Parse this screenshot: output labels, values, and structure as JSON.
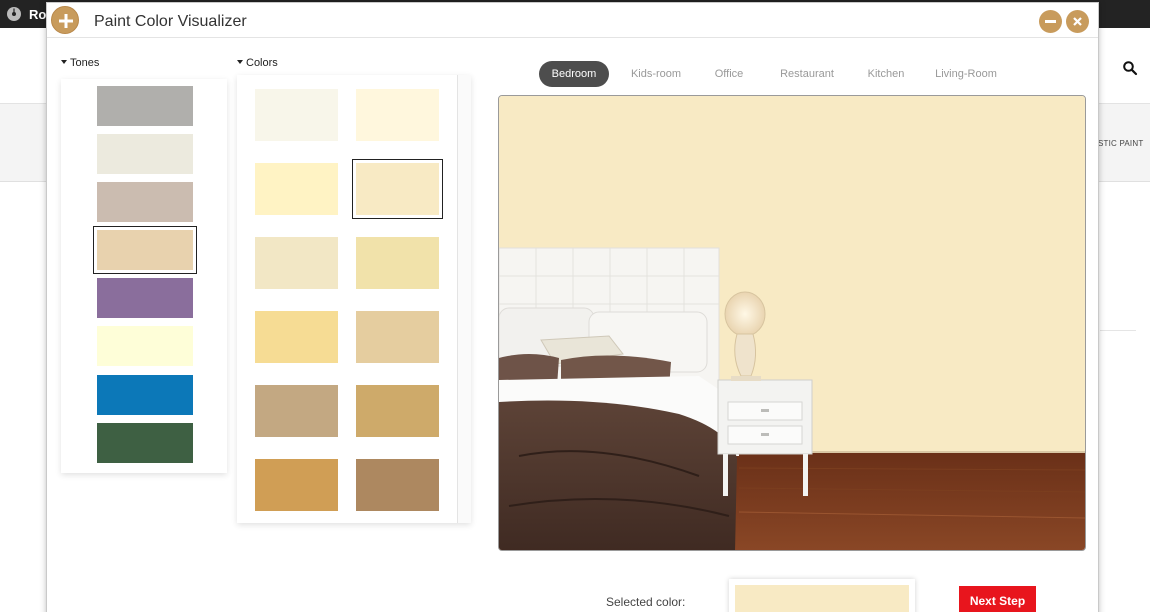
{
  "background": {
    "brand": "Ro",
    "nav_partial_text": "STIC PAINT"
  },
  "modal": {
    "title": "Paint Color Visualizer",
    "accent_color": "#c89b5c"
  },
  "tones": {
    "label": "Tones",
    "items": [
      {
        "color": "#b0afac"
      },
      {
        "color": "#eceade"
      },
      {
        "color": "#cbbcb0"
      },
      {
        "color": "#e8d2ae",
        "selected": true
      },
      {
        "color": "#8a6e9c"
      },
      {
        "color": "#fefed8"
      },
      {
        "color": "#0c78b8"
      },
      {
        "color": "#3e6043"
      }
    ]
  },
  "colors": {
    "label": "Colors",
    "items": [
      {
        "color": "#f8f6ea"
      },
      {
        "color": "#fff7dd"
      },
      {
        "color": "#fff3c4"
      },
      {
        "color": "#f8eac4",
        "selected": true
      },
      {
        "color": "#f2e7c5"
      },
      {
        "color": "#f1e2aa"
      },
      {
        "color": "#f6dc94"
      },
      {
        "color": "#e5cd9f"
      },
      {
        "color": "#c3a882"
      },
      {
        "color": "#ceaa6a"
      },
      {
        "color": "#d09e55"
      },
      {
        "color": "#ad8860"
      }
    ]
  },
  "rooms": {
    "tabs": [
      {
        "label": "Bedroom",
        "active": true
      },
      {
        "label": "Kids-room"
      },
      {
        "label": "Office"
      },
      {
        "label": "Restaurant"
      },
      {
        "label": "Kitchen"
      },
      {
        "label": "Living-Room"
      }
    ]
  },
  "preview": {
    "wall_color": "#f8eac4"
  },
  "footer": {
    "selected_label": "Selected color:",
    "selected_color": "#f8eac4",
    "next_step_label": "Next Step",
    "next_step_color": "#e8151d"
  }
}
